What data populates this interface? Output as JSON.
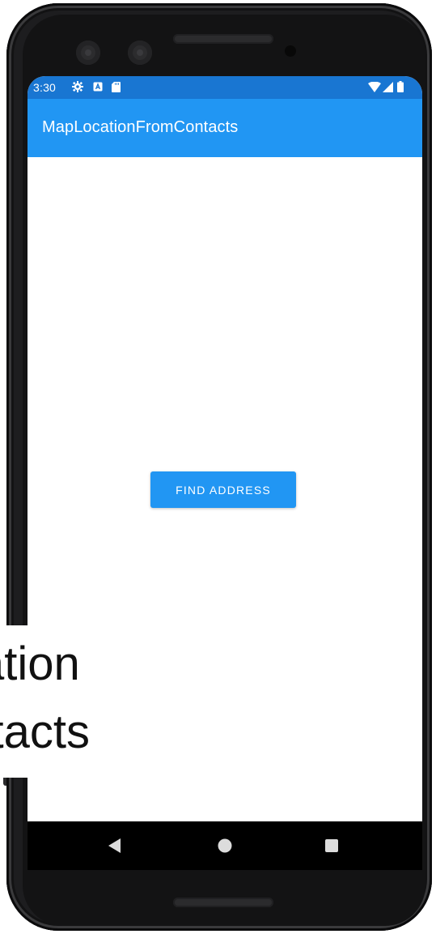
{
  "status_bar": {
    "time": "3:30",
    "icons": [
      "settings-icon",
      "keyboard-a-icon",
      "sd-card-icon",
      "wifi-icon",
      "signal-icon",
      "battery-icon"
    ]
  },
  "app_bar": {
    "title": "MapLocationFromContacts"
  },
  "main": {
    "find_address_label": "FIND ADDRESS"
  },
  "nav_bar": {
    "items": [
      "back-icon",
      "home-icon",
      "recents-icon"
    ]
  },
  "overlay_caption": {
    "line1": "cation",
    "line2": "ontacts"
  },
  "colors": {
    "status_bar": "#1976d2",
    "app_bar": "#2196f3",
    "button": "#2196f3",
    "device_frame": "#1d1d1f"
  }
}
